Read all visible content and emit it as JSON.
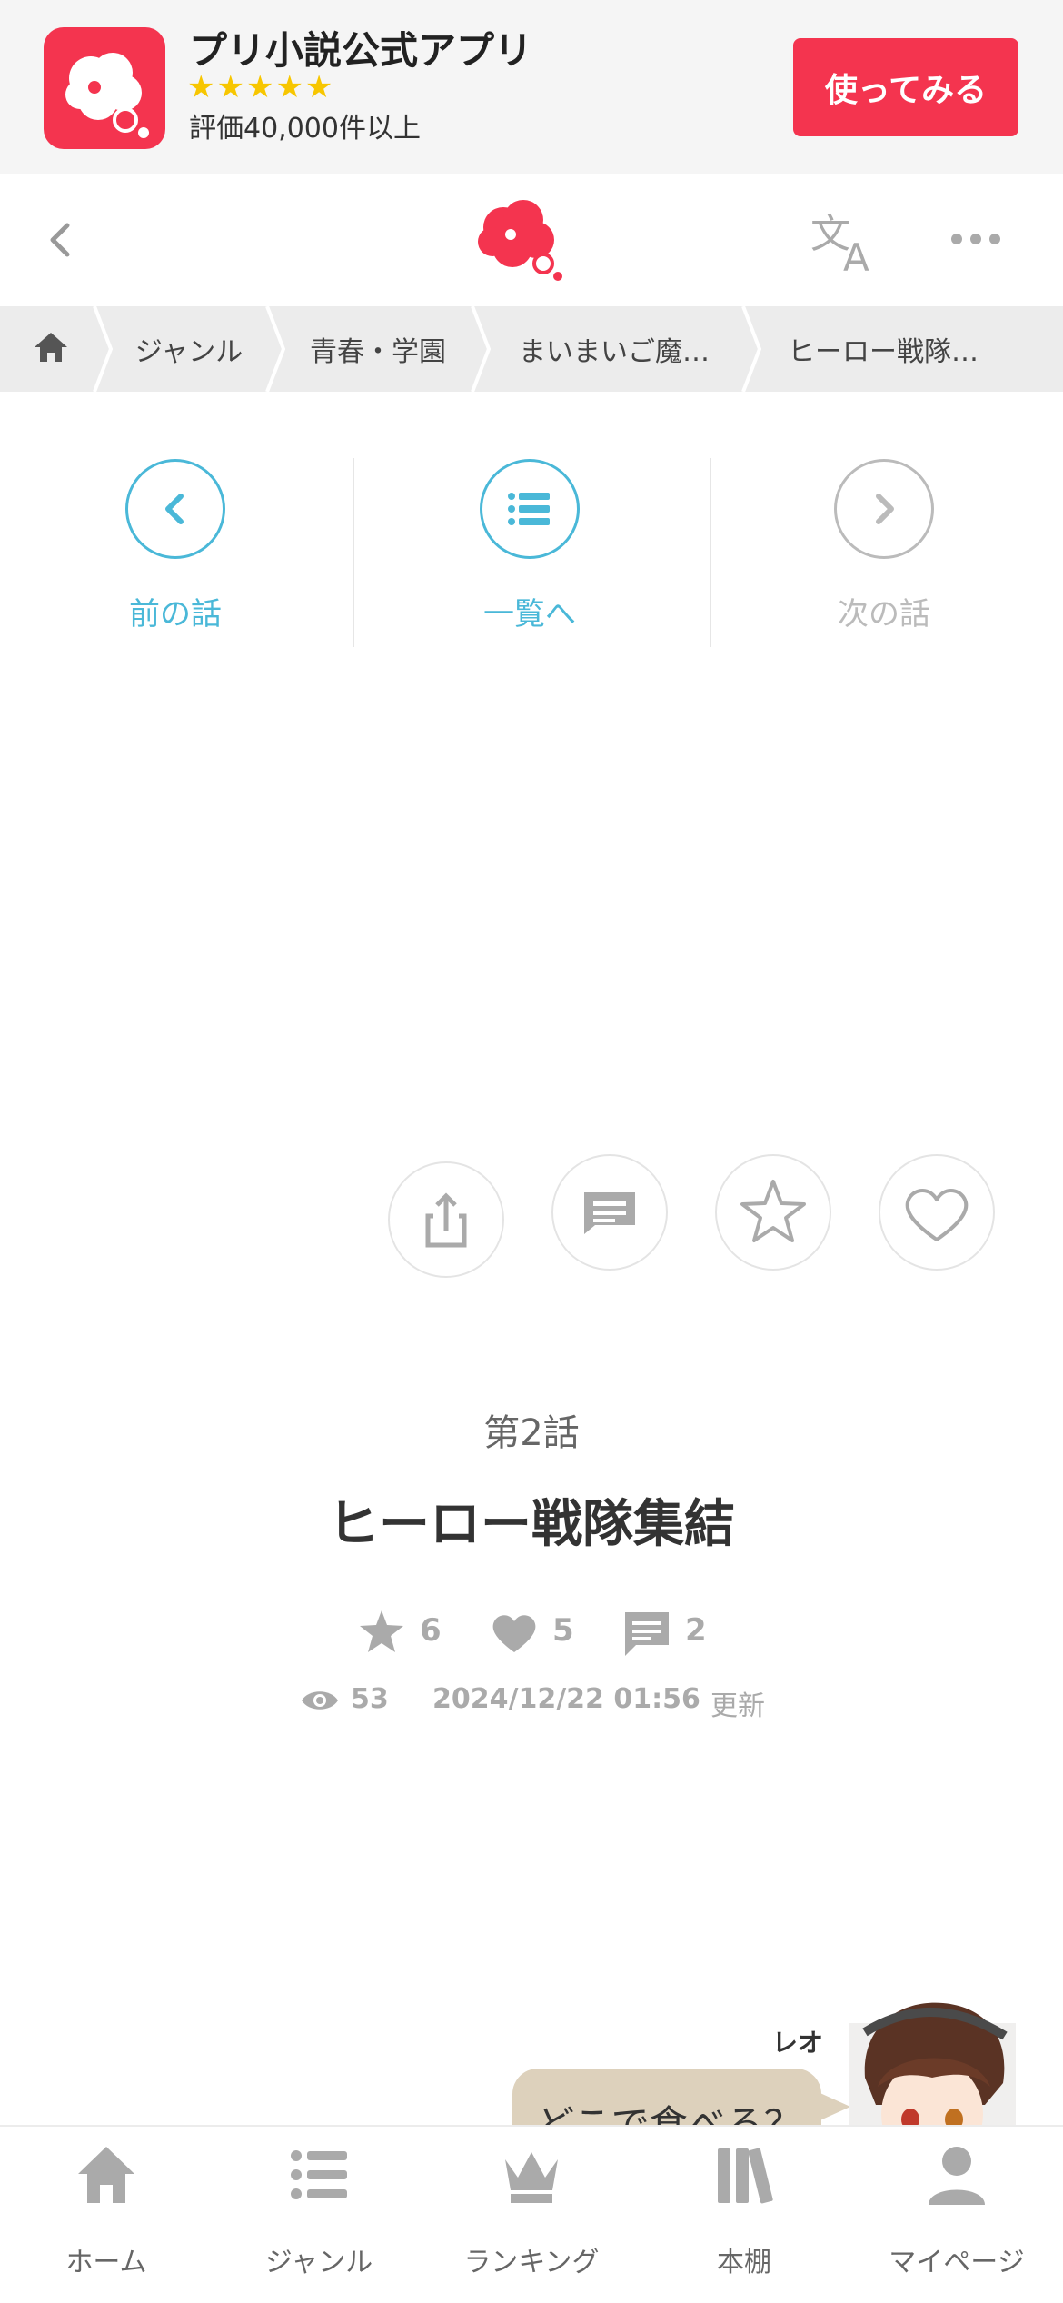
{
  "app_banner": {
    "title": "プリ小説公式アプリ",
    "stars": "★★★★★",
    "rating_text": "評価40,000件以上",
    "cta_label": "使ってみる"
  },
  "breadcrumb": [
    "ジャンル",
    "青春・学園",
    "まいまいご魔…",
    "ヒーロー戦隊…"
  ],
  "nav": {
    "prev_label": "前の話",
    "list_label": "一覧へ",
    "next_label": "次の話"
  },
  "episode": {
    "number": "第2話",
    "title": "ヒーロー戦隊集結",
    "stars": "6",
    "likes": "5",
    "comments": "2",
    "views": "53",
    "updated": "2024/12/22 01:56",
    "updated_suffix": "更新"
  },
  "chat_teaser": {
    "speaker": "レオ",
    "message": "どこで食べる？"
  },
  "tabbar": {
    "home": "ホーム",
    "genre": "ジャンル",
    "ranking": "ランキング",
    "bookshelf": "本棚",
    "mypage": "マイページ"
  },
  "colors": {
    "brand": "#f4344f",
    "accent": "#4ab8d8",
    "muted": "#aaaaaa"
  }
}
